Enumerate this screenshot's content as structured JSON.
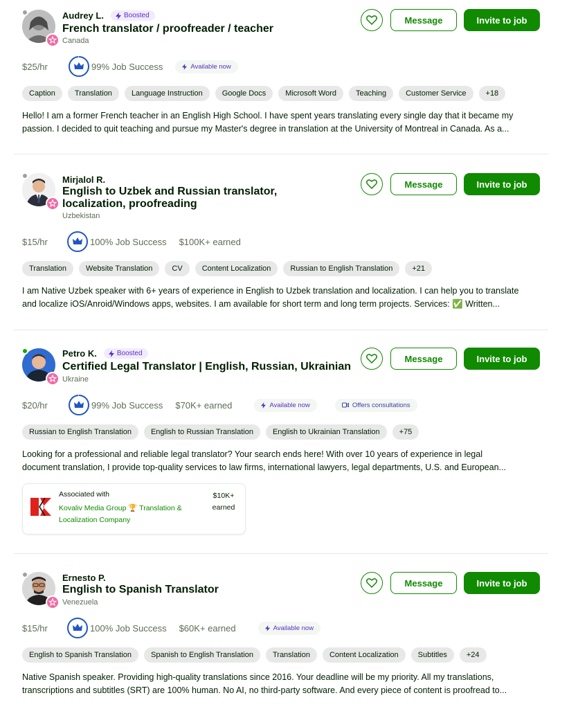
{
  "freelancers": [
    {
      "name": "Audrey L.",
      "boosted": "Boosted",
      "title": "French translator / proofreader / teacher",
      "country": "Canada",
      "rate": "$25/hr",
      "job_success": "99% Job Success",
      "earned": "",
      "badges": [
        "Available now"
      ],
      "skills": [
        "Caption",
        "Translation",
        "Language Instruction",
        "Google Docs",
        "Microsoft Word",
        "Teaching",
        "Customer Service",
        "+18"
      ],
      "description_lines": [
        "Hello! I am a former French teacher in an English High School. I have spent years translating every single day that it became my",
        "passion. I decided to quit teaching and pursue my Master's degree in translation at the University of Montreal in Canada. As a..."
      ],
      "online": false
    },
    {
      "name": "Mirjalol R.",
      "boosted": "",
      "title": "English to Uzbek and Russian translator, localization, proofreading",
      "country": "Uzbekistan",
      "rate": "$15/hr",
      "job_success": "100% Job Success",
      "earned": "$100K+ earned",
      "badges": [],
      "skills": [
        "Translation",
        "Website Translation",
        "CV",
        "Content Localization",
        "Russian to English Translation",
        "+21"
      ],
      "description_lines": [
        "I am Native Uzbek speaker with 6+ years of experience in English to Uzbek translation and localization. I can help you to translate",
        "and localize iOS/Anroid/Windows apps, websites. I am available for short term and long term projects. Services: ✅ Written..."
      ],
      "online": false
    },
    {
      "name": "Petro K.",
      "boosted": "Boosted",
      "title": "Certified Legal Translator | English, Russian, Ukrainian",
      "country": "Ukraine",
      "rate": "$20/hr",
      "job_success": "99% Job Success",
      "earned": "$70K+ earned",
      "badges": [
        "Available now",
        "Offers consultations"
      ],
      "skills": [
        "Russian to English Translation",
        "English to Russian Translation",
        "English to Ukrainian Translation",
        "+75"
      ],
      "description_lines": [
        "Looking for a professional and reliable legal translator? Your search ends here! With over 10 years of experience in legal",
        "document translation, I provide top-quality services to law firms, international lawyers, legal departments, U.S. and European..."
      ],
      "online": true,
      "association": {
        "label": "Associated with",
        "company": "Kovaliv Media Group 🏆 Translation & Localization Company",
        "earned_amount": "$10K+",
        "earned_label": "earned"
      }
    },
    {
      "name": "Ernesto P.",
      "boosted": "",
      "title": "English to Spanish Translator",
      "country": "Venezuela",
      "rate": "$15/hr",
      "job_success": "100% Job Success",
      "earned": "$60K+ earned",
      "badges": [
        "Available now"
      ],
      "skills": [
        "English to Spanish Translation",
        "Spanish to English Translation",
        "Translation",
        "Content Localization",
        "Subtitles",
        "+24"
      ],
      "description_lines": [
        "Native Spanish speaker. Providing high-quality translations since 2016. Your deadline will be my priority. All my translations,",
        "transcriptions and subtitles (SRT) are 100% human. No AI, no third-party software. And every piece of content is proofread to..."
      ],
      "online": false
    }
  ],
  "actions": {
    "message_label": "Message",
    "invite_label": "Invite to job"
  },
  "colors": {
    "brand_green": "#108a00",
    "boost_purple": "#5b2fc2",
    "skill_bg": "#e8e8e8",
    "top_rated_pink": "#f069a4"
  }
}
